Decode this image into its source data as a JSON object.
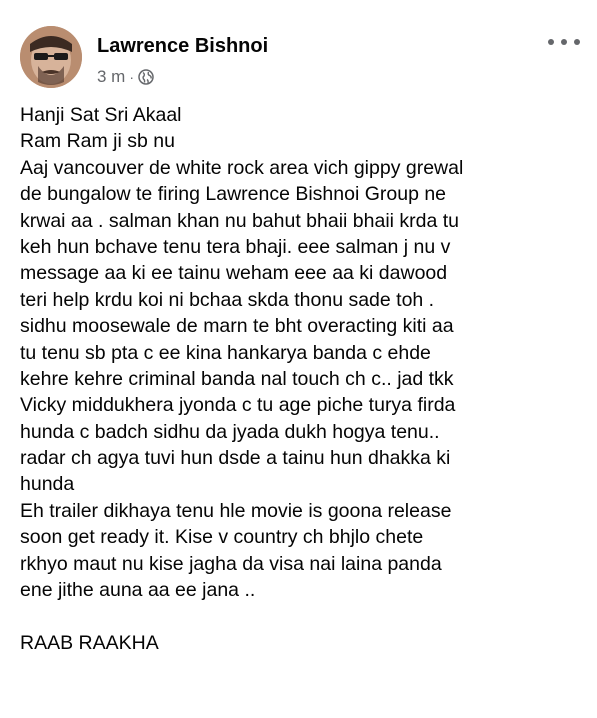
{
  "post": {
    "author": "Lawrence Bishnoi",
    "time": "3 m",
    "separator": "·",
    "privacy_icon": "globe-icon",
    "more_icon": "more-horizontal-icon",
    "body_lines": [
      "Hanji Sat Sri Akaal",
      "Ram Ram ji sb nu",
      "Aaj vancouver de white rock area vich gippy grewal",
      "de bungalow te firing Lawrence Bishnoi Group ne",
      "krwai aa . salman khan nu bahut bhaii bhaii krda tu",
      "keh hun bchave tenu tera bhaji. eee salman j nu v",
      "message aa ki ee tainu weham eee aa ki dawood",
      "teri help krdu koi ni bchaa skda thonu sade toh .",
      "sidhu moosewale de marn te bht overacting kiti aa",
      "tu tenu sb pta c ee kina hankarya banda c ehde",
      "kehre kehre criminal banda nal touch ch c.. jad tkk",
      "Vicky middukhera jyonda c tu age piche turya firda",
      "hunda c badch sidhu da jyada dukh hogya tenu..",
      "radar ch agya tuvi hun dsde a tainu hun dhakka ki",
      "hunda",
      "Eh trailer dikhaya tenu hle movie is goona release",
      "soon get ready it. Kise v country ch bhjlo chete",
      "rkhyo maut nu kise jagha da visa nai laina panda",
      "ene jithe auna aa ee jana .."
    ],
    "closing": "RAAB RAAKHA"
  },
  "colors": {
    "text": "#050505",
    "secondary_text": "#65676b",
    "background": "#ffffff"
  }
}
